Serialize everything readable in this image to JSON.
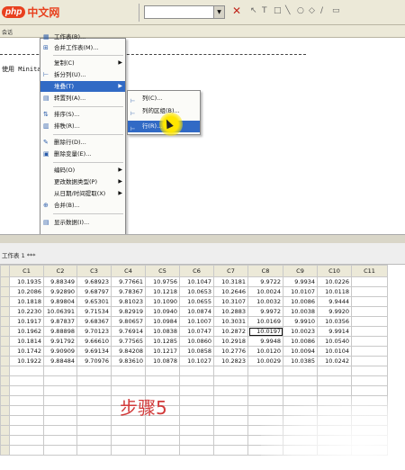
{
  "logo": {
    "mark": "php",
    "text": "中文网"
  },
  "subbar": {
    "label": "会话"
  },
  "session": {
    "text": "使用 Minitab"
  },
  "menu": {
    "items": [
      {
        "label": "工作表(B)...",
        "icon": "worksheet-icon",
        "has_sub": false
      },
      {
        "label": "合并工作表(M)...",
        "icon": "merge-icon",
        "has_sub": false
      },
      {
        "label": "复制(C)",
        "icon": "",
        "has_sub": true
      },
      {
        "label": "拆分列(U)...",
        "icon": "split-icon",
        "has_sub": false
      },
      {
        "label": "堆叠(T)",
        "icon": "",
        "has_sub": true,
        "highlighted": true
      },
      {
        "label": "转置列(A)...",
        "icon": "transpose-icon",
        "has_sub": false
      },
      {
        "label": "排序(S)...",
        "icon": "sort-icon",
        "has_sub": false
      },
      {
        "label": "排秩(R)...",
        "icon": "rank-icon",
        "has_sub": false
      },
      {
        "label": "删除行(D)...",
        "icon": "delete-rows-icon",
        "has_sub": false
      },
      {
        "label": "删除变量(E)...",
        "icon": "delete-vars-icon",
        "has_sub": false
      },
      {
        "label": "编码(O)",
        "icon": "",
        "has_sub": true
      },
      {
        "label": "更改数据类型(P)",
        "icon": "",
        "has_sub": true
      },
      {
        "label": "从日期/时间提取(X)",
        "icon": "",
        "has_sub": true
      },
      {
        "label": "合并(B)...",
        "icon": "combine-icon",
        "has_sub": false
      },
      {
        "label": "显示数据(I)...",
        "icon": "display-icon",
        "has_sub": false
      }
    ]
  },
  "submenu": {
    "items": [
      {
        "label": "列(C)...",
        "highlighted": false
      },
      {
        "label": "列的区组(B)...",
        "highlighted": false
      },
      {
        "label": "行(R)...",
        "highlighted": true
      }
    ]
  },
  "worksheet": {
    "title": "工作表 1 ***",
    "columns": [
      "C1",
      "C2",
      "C3",
      "C4",
      "C5",
      "C6",
      "C7",
      "C8",
      "C9",
      "C10",
      "C11"
    ],
    "rows": [
      [
        "10.1935",
        "9.88349",
        "9.68923",
        "9.77661",
        "10.9756",
        "10.1047",
        "10.3181",
        "9.9722",
        "9.9934",
        "10.0226",
        ""
      ],
      [
        "10.2086",
        "9.92890",
        "9.68797",
        "9.78367",
        "10.1218",
        "10.0653",
        "10.2646",
        "10.0024",
        "10.0107",
        "10.0118",
        ""
      ],
      [
        "10.1818",
        "9.89804",
        "9.65301",
        "9.81023",
        "10.1090",
        "10.0655",
        "10.3107",
        "10.0032",
        "10.0086",
        "9.9444",
        ""
      ],
      [
        "10.2230",
        "10.06391",
        "9.71534",
        "9.82919",
        "10.0940",
        "10.0874",
        "10.2883",
        "9.9972",
        "10.0038",
        "9.9920",
        ""
      ],
      [
        "10.1917",
        "9.87837",
        "9.68367",
        "9.80657",
        "10.0984",
        "10.1007",
        "10.3031",
        "10.0169",
        "9.9910",
        "10.0356",
        ""
      ],
      [
        "10.1962",
        "9.88898",
        "9.70123",
        "9.76914",
        "10.0838",
        "10.0747",
        "10.2872",
        "10.0197",
        "10.0023",
        "9.9914",
        ""
      ],
      [
        "10.1814",
        "9.91792",
        "9.66610",
        "9.77565",
        "10.1285",
        "10.0860",
        "10.2918",
        "9.9948",
        "10.0086",
        "10.0540",
        ""
      ],
      [
        "10.1742",
        "9.90909",
        "9.69134",
        "9.84208",
        "10.1217",
        "10.0858",
        "10.2776",
        "10.0120",
        "10.0094",
        "10.0104",
        ""
      ],
      [
        "10.1922",
        "9.88484",
        "9.70976",
        "9.83610",
        "10.0878",
        "10.1027",
        "10.2823",
        "10.0029",
        "10.0385",
        "10.0242",
        ""
      ]
    ],
    "selected_cell": {
      "row": 5,
      "col": 7
    }
  },
  "annotation": {
    "text": "步骤5",
    "color": "#d23a3a"
  },
  "colors": {
    "highlight": "#316ac5",
    "toolbar": "#ece9d8"
  }
}
